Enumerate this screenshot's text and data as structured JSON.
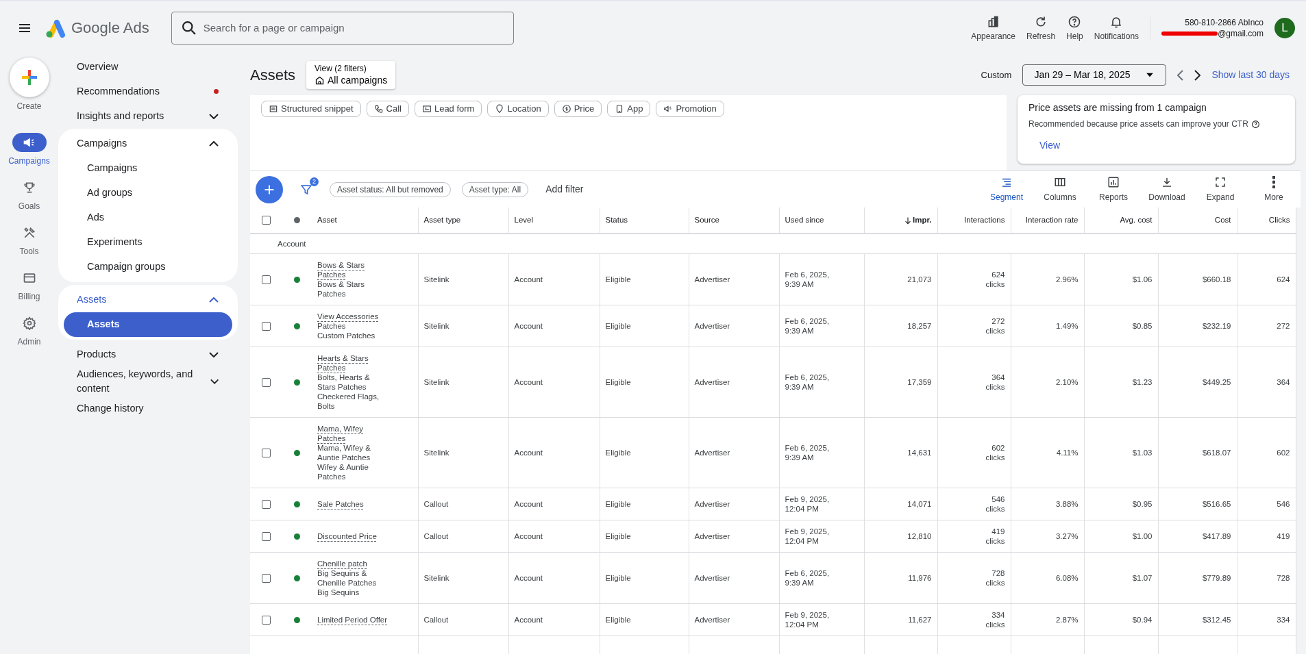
{
  "app": {
    "title": "Google Ads"
  },
  "search": {
    "placeholder": "Search for a page or campaign"
  },
  "header_actions": [
    {
      "kind": "appearance",
      "label": "Appearance"
    },
    {
      "kind": "refresh",
      "label": "Refresh"
    },
    {
      "kind": "help",
      "label": "Help"
    },
    {
      "kind": "notifications",
      "label": "Notifications"
    }
  ],
  "account": {
    "name": "580-810-2866 AbInco",
    "email": "@gmail.com",
    "email_redacted": true,
    "avatar": "L"
  },
  "rail": [
    {
      "kind": "create",
      "label": "Create",
      "selected": false
    },
    {
      "kind": "campaigns",
      "label": "Campaigns",
      "selected": true
    },
    {
      "kind": "goals",
      "label": "Goals",
      "selected": false
    },
    {
      "kind": "tools",
      "label": "Tools",
      "selected": false
    },
    {
      "kind": "billing",
      "label": "Billing",
      "selected": false
    },
    {
      "kind": "admin",
      "label": "Admin",
      "selected": false
    }
  ],
  "nav": [
    {
      "label": "Overview",
      "selected": false
    },
    {
      "label": "Recommendations",
      "selected": false,
      "alert": true
    },
    {
      "label": "Insights and reports",
      "selected": false,
      "expanded": false
    },
    {
      "label": "Campaigns",
      "selected": false,
      "expanded": true,
      "children": [
        {
          "label": "Campaigns",
          "selected": false
        },
        {
          "label": "Ad groups",
          "selected": false
        },
        {
          "label": "Ads",
          "selected": false
        },
        {
          "label": "Experiments",
          "selected": false
        },
        {
          "label": "Campaign groups",
          "selected": false
        }
      ]
    },
    {
      "label": "Assets",
      "selected": true,
      "expanded": true,
      "children": [
        {
          "label": "Assets",
          "selected": true
        }
      ]
    },
    {
      "label": "Products",
      "selected": false,
      "expanded": false
    },
    {
      "label": "Audiences, keywords, and content",
      "selected": false,
      "expanded": false
    },
    {
      "label": "Change history",
      "selected": false
    }
  ],
  "page": {
    "title": "Assets",
    "view_label": "View (2 filters)",
    "view_value": "All campaigns"
  },
  "date_range": {
    "label": "Custom",
    "value": "Jan 29 – Mar 18, 2025",
    "link": "Show last 30 days"
  },
  "asset_type_chips": [
    {
      "kind": "snippet",
      "label": "Structured snippet"
    },
    {
      "kind": "call",
      "label": "Call"
    },
    {
      "kind": "form",
      "label": "Lead form"
    },
    {
      "kind": "location",
      "label": "Location"
    },
    {
      "kind": "price",
      "label": "Price"
    },
    {
      "kind": "app",
      "label": "App"
    },
    {
      "kind": "promotion",
      "label": "Promotion"
    }
  ],
  "recommendation": {
    "title": "Price assets are missing from 1 campaign",
    "text": "Recommended because price assets can improve your CTR",
    "action": "View"
  },
  "filters": {
    "count": "2",
    "chips": [
      "Asset status: All but removed",
      "Asset type: All"
    ],
    "add": "Add filter"
  },
  "toolbar": [
    {
      "kind": "segment",
      "label": "Segment",
      "selected": true
    },
    {
      "kind": "columns",
      "label": "Columns",
      "selected": false
    },
    {
      "kind": "reports",
      "label": "Reports",
      "selected": false
    },
    {
      "kind": "download",
      "label": "Download",
      "selected": false
    },
    {
      "kind": "expand",
      "label": "Expand",
      "selected": false
    },
    {
      "kind": "more",
      "label": "More",
      "selected": false
    }
  ],
  "table": {
    "header_checked": false,
    "columns": [
      {
        "label": "Asset",
        "sorted": false
      },
      {
        "label": "Asset type",
        "sorted": false
      },
      {
        "label": "Level",
        "sorted": false
      },
      {
        "label": "Status",
        "sorted": false
      },
      {
        "label": "Source",
        "sorted": false
      },
      {
        "label": "Used since",
        "sorted": false
      },
      {
        "label": "Impr.",
        "sorted": true
      },
      {
        "label": "Interactions",
        "sorted": false
      },
      {
        "label": "Interaction rate",
        "sorted": false
      },
      {
        "label": "Avg. cost",
        "sorted": false
      },
      {
        "label": "Cost",
        "sorted": false
      },
      {
        "label": "Clicks",
        "sorted": false
      }
    ],
    "group": "Account",
    "rows": [
      {
        "checked": false,
        "color": "#188038",
        "title": "Bows & Stars Patches",
        "lines": [
          "Bows & Stars Patches"
        ],
        "type": "Sitelink",
        "level": "Account",
        "status": "Eligible",
        "source": "Advertiser",
        "date": "Feb 6, 2025,",
        "time": "9:39 AM",
        "impr": "21,073",
        "interactions": "624",
        "unit": "clicks",
        "rate": "2.96%",
        "avg_cost": "$1.06",
        "cost": "$660.18",
        "clicks": "624"
      },
      {
        "checked": false,
        "color": "#188038",
        "title": "View Accessories",
        "lines": [
          "Patches",
          "Custom Patches"
        ],
        "type": "Sitelink",
        "level": "Account",
        "status": "Eligible",
        "source": "Advertiser",
        "date": "Feb 6, 2025,",
        "time": "9:39 AM",
        "impr": "18,257",
        "interactions": "272",
        "unit": "clicks",
        "rate": "1.49%",
        "avg_cost": "$0.85",
        "cost": "$232.19",
        "clicks": "272"
      },
      {
        "checked": false,
        "color": "#188038",
        "title": "Hearts & Stars Patches",
        "lines": [
          "Bolts, Hearts & Stars Patches",
          "Checkered Flags, Bolts"
        ],
        "type": "Sitelink",
        "level": "Account",
        "status": "Eligible",
        "source": "Advertiser",
        "date": "Feb 6, 2025,",
        "time": "9:39 AM",
        "impr": "17,359",
        "interactions": "364",
        "unit": "clicks",
        "rate": "2.10%",
        "avg_cost": "$1.23",
        "cost": "$449.25",
        "clicks": "364"
      },
      {
        "checked": false,
        "color": "#188038",
        "title": "Mama, Wifey Patches",
        "lines": [
          "Mama, Wifey & Auntie Patches",
          "Wifey & Auntie Patches"
        ],
        "type": "Sitelink",
        "level": "Account",
        "status": "Eligible",
        "source": "Advertiser",
        "date": "Feb 6, 2025,",
        "time": "9:39 AM",
        "impr": "14,631",
        "interactions": "602",
        "unit": "clicks",
        "rate": "4.11%",
        "avg_cost": "$1.03",
        "cost": "$618.07",
        "clicks": "602"
      },
      {
        "checked": false,
        "color": "#188038",
        "title": "Sale Patches",
        "lines": [],
        "type": "Callout",
        "level": "Account",
        "status": "Eligible",
        "source": "Advertiser",
        "date": "Feb 9, 2025,",
        "time": "12:04 PM",
        "impr": "14,071",
        "interactions": "546",
        "unit": "clicks",
        "rate": "3.88%",
        "avg_cost": "$0.95",
        "cost": "$516.65",
        "clicks": "546"
      },
      {
        "checked": false,
        "color": "#188038",
        "title": "Discounted Price",
        "lines": [],
        "type": "Callout",
        "level": "Account",
        "status": "Eligible",
        "source": "Advertiser",
        "date": "Feb 9, 2025,",
        "time": "12:04 PM",
        "impr": "12,810",
        "interactions": "419",
        "unit": "clicks",
        "rate": "3.27%",
        "avg_cost": "$1.00",
        "cost": "$417.89",
        "clicks": "419"
      },
      {
        "checked": false,
        "color": "#188038",
        "title": "Chenille patch",
        "lines": [
          "Big Sequins & Chenille Patches",
          "Big Sequins"
        ],
        "type": "Sitelink",
        "level": "Account",
        "status": "Eligible",
        "source": "Advertiser",
        "date": "Feb 6, 2025,",
        "time": "9:39 AM",
        "impr": "11,976",
        "interactions": "728",
        "unit": "clicks",
        "rate": "6.08%",
        "avg_cost": "$1.07",
        "cost": "$779.89",
        "clicks": "728"
      },
      {
        "checked": false,
        "color": "#188038",
        "title": "Limited Period Offer",
        "lines": [],
        "type": "Callout",
        "level": "Account",
        "status": "Eligible",
        "source": "Advertiser",
        "date": "Feb 9, 2025,",
        "time": "12:04 PM",
        "impr": "11,627",
        "interactions": "334",
        "unit": "clicks",
        "rate": "2.87%",
        "avg_cost": "$0.94",
        "cost": "$312.45",
        "clicks": "334"
      }
    ]
  }
}
